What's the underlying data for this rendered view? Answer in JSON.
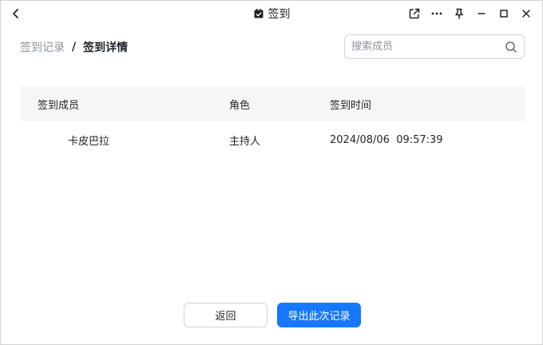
{
  "titlebar": {
    "title": "签到",
    "icons": [
      "back-icon",
      "calendar-check-icon",
      "share-out-icon",
      "more-icon",
      "pin-icon",
      "minimize-icon",
      "maximize-icon",
      "close-icon"
    ]
  },
  "breadcrumb": {
    "parent": "签到记录",
    "separator": "/",
    "current": "签到详情"
  },
  "search": {
    "placeholder": "搜索成员",
    "value": ""
  },
  "table": {
    "columns": [
      "签到成员",
      "角色",
      "签到时间"
    ],
    "rows": [
      {
        "member": "卡皮巴拉",
        "role": "主持人",
        "time": "2024/08/06  09:57:39"
      }
    ]
  },
  "footer": {
    "return_label": "返回",
    "export_label": "导出此次记录"
  },
  "colors": {
    "accent": "#1677ff",
    "header_bg": "#f5f6f7",
    "muted_text": "#8f959e",
    "text": "#1f2329",
    "border": "#d0d3d6"
  }
}
